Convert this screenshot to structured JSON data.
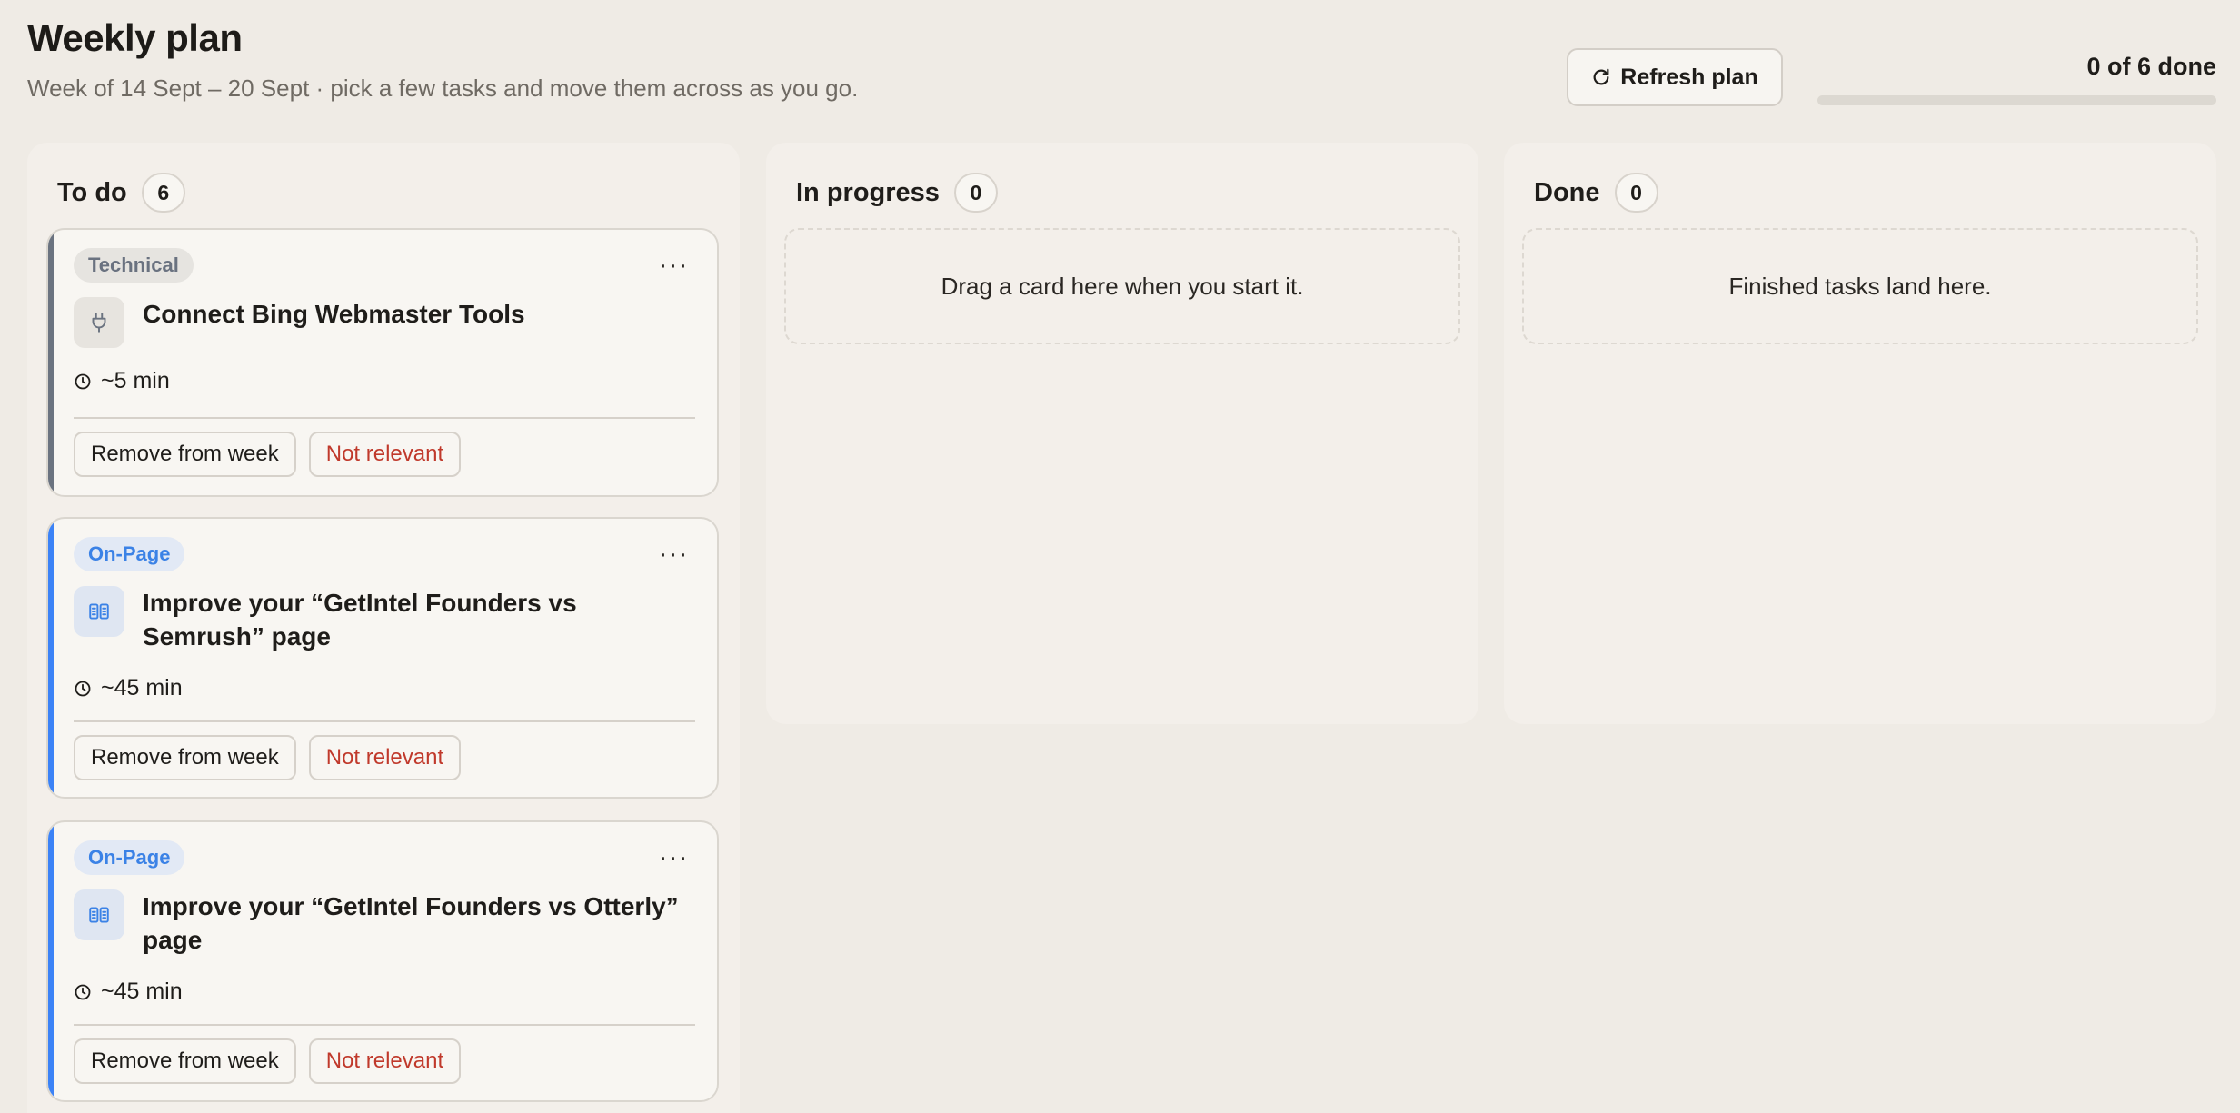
{
  "header": {
    "title": "Weekly plan",
    "subtitle": "Week of 14 Sept – 20 Sept · pick a few tasks and move them across as you go.",
    "refresh_label": "Refresh plan",
    "progress_label": "0 of 6 done",
    "progress_fraction": 0
  },
  "columns": {
    "todo": {
      "title": "To do",
      "count": "6"
    },
    "in_progress": {
      "title": "In progress",
      "count": "0",
      "empty_text": "Drag a card here when you start it."
    },
    "done": {
      "title": "Done",
      "count": "0",
      "empty_text": "Finished tasks land here."
    }
  },
  "cards": [
    {
      "tag": "Technical",
      "title": "Connect Bing Webmaster Tools",
      "duration": "~5 min",
      "icon": "plug-icon",
      "accent": "#6b7380",
      "remove_label": "Remove from week",
      "dismiss_label": "Not relevant"
    },
    {
      "tag": "On-Page",
      "title": "Improve your “GetIntel Founders vs Semrush” page",
      "duration": "~45 min",
      "icon": "columns-icon",
      "accent": "#3b82f6",
      "remove_label": "Remove from week",
      "dismiss_label": "Not relevant"
    },
    {
      "tag": "On-Page",
      "title": "Improve your “GetIntel Founders vs Otterly” page",
      "duration": "~45 min",
      "icon": "columns-icon",
      "accent": "#3b82f6",
      "remove_label": "Remove from week",
      "dismiss_label": "Not relevant"
    }
  ],
  "colors": {
    "background": "#efebe5",
    "danger": "#c0392b",
    "onpage": "#3b82e6",
    "technical": "#6a7280"
  }
}
